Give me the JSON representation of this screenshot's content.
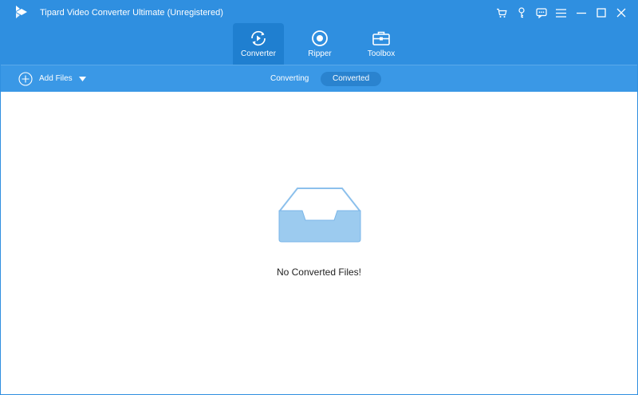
{
  "titlebar": {
    "title": "Tipard Video Converter Ultimate (Unregistered)",
    "logo_icon": "tipard-logo-icon",
    "controls": [
      "cart-icon",
      "key-icon",
      "chat-icon",
      "menu-icon",
      "minimize-icon",
      "maximize-icon",
      "close-icon"
    ]
  },
  "nav": {
    "tabs": [
      {
        "label": "Converter",
        "icon": "converter-icon",
        "active": true
      },
      {
        "label": "Ripper",
        "icon": "ripper-icon",
        "active": false
      },
      {
        "label": "Toolbox",
        "icon": "toolbox-icon",
        "active": false
      }
    ]
  },
  "toolbar": {
    "add_files_label": "Add Files",
    "subtabs": [
      {
        "label": "Converting",
        "active": false
      },
      {
        "label": "Converted",
        "active": true
      }
    ]
  },
  "main": {
    "empty_message": "No Converted Files!",
    "empty_icon": "empty-inbox-icon"
  },
  "colors": {
    "brand_blue": "#2f8fe0",
    "toolbar_blue": "#3a98e6",
    "active_tab": "#1f7fd0",
    "inbox_fill": "#9ccbef",
    "inbox_stroke": "#5ea8e6"
  }
}
